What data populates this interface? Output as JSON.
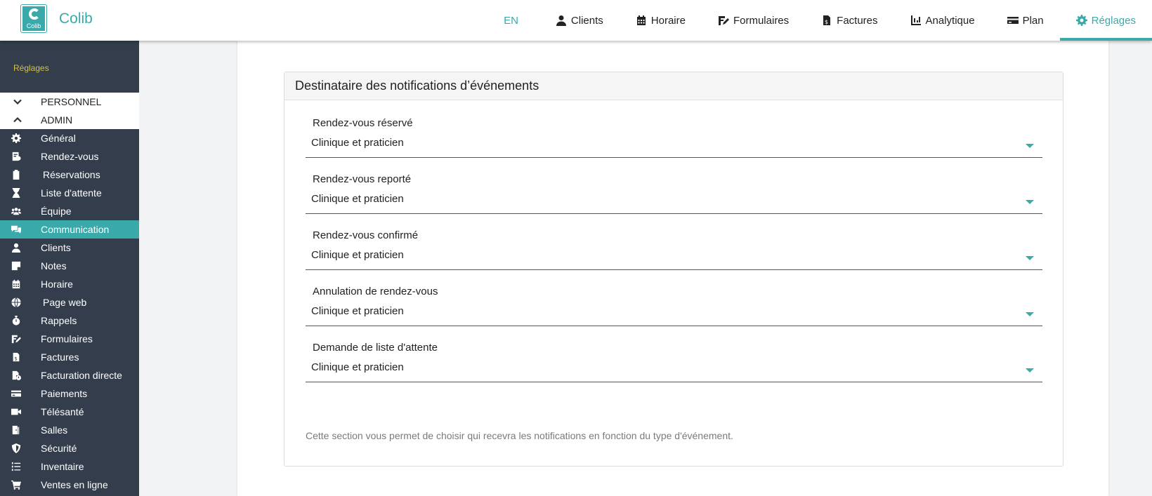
{
  "app": {
    "name": "Colib",
    "logo_text": "Colib"
  },
  "nav": {
    "lang": "EN",
    "items": [
      {
        "label": "Clients",
        "icon": "user-icon"
      },
      {
        "label": "Horaire",
        "icon": "calendar-icon"
      },
      {
        "label": "Formulaires",
        "icon": "form-icon"
      },
      {
        "label": "Factures",
        "icon": "invoice-icon"
      },
      {
        "label": "Analytique",
        "icon": "chart-icon"
      },
      {
        "label": "Plan",
        "icon": "credit-card-icon"
      },
      {
        "label": "Réglages",
        "icon": "gear-icon",
        "active": true
      }
    ]
  },
  "sidebar": {
    "title": "Réglages",
    "sections": [
      {
        "label": "PERSONNEL",
        "state": "collapsed"
      },
      {
        "label": "ADMIN",
        "state": "expanded"
      }
    ],
    "items": [
      {
        "label": "Général",
        "icon": "gear-icon"
      },
      {
        "label": "Rendez-vous",
        "icon": "appointment-icon"
      },
      {
        "label": "Réservations",
        "icon": "clipboard-icon"
      },
      {
        "label": "Liste d'attente",
        "icon": "hourglass-icon"
      },
      {
        "label": "Équipe",
        "icon": "team-icon"
      },
      {
        "label": "Communication",
        "icon": "chat-icon",
        "active": true
      },
      {
        "label": "Clients",
        "icon": "user-icon"
      },
      {
        "label": "Notes",
        "icon": "note-icon"
      },
      {
        "label": "Horaire",
        "icon": "calendar-icon"
      },
      {
        "label": "Page web",
        "icon": "globe-icon"
      },
      {
        "label": "Rappels",
        "icon": "stopwatch-icon"
      },
      {
        "label": "Formulaires",
        "icon": "form-icon"
      },
      {
        "label": "Factures",
        "icon": "invoice-icon"
      },
      {
        "label": "Facturation directe",
        "icon": "direct-billing-icon"
      },
      {
        "label": "Paiements",
        "icon": "credit-card-icon"
      },
      {
        "label": "Télésanté",
        "icon": "video-icon"
      },
      {
        "label": "Salles",
        "icon": "door-icon"
      },
      {
        "label": "Sécurité",
        "icon": "shield-icon"
      },
      {
        "label": "Inventaire",
        "icon": "list-icon"
      },
      {
        "label": "Ventes en ligne",
        "icon": "cart-icon"
      }
    ]
  },
  "panel": {
    "title": "Destinataire des notifications d’événements",
    "fields": [
      {
        "label": "Rendez-vous réservé",
        "value": "Clinique et praticien"
      },
      {
        "label": "Rendez-vous reporté",
        "value": "Clinique et praticien"
      },
      {
        "label": "Rendez-vous confirmé",
        "value": "Clinique et praticien"
      },
      {
        "label": "Annulation de rendez-vous",
        "value": "Clinique et praticien"
      },
      {
        "label": "Demande de liste d'attente",
        "value": "Clinique et praticien"
      }
    ],
    "hint": "Cette section vous permet de choisir qui recevra les notifications en fonction du type d'événement."
  },
  "colors": {
    "accent": "#3aa9aa",
    "sidebar_bg": "#333d4b",
    "sidebar_title": "#d6c04a"
  }
}
